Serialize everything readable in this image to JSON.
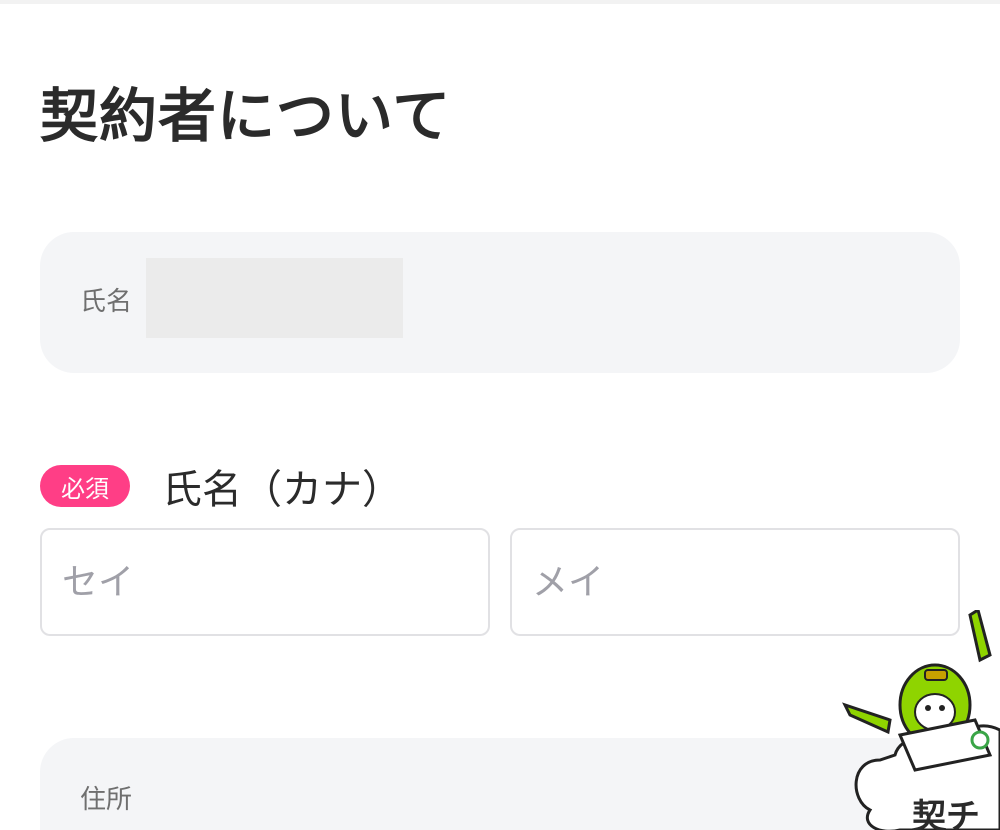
{
  "section": {
    "title": "契約者について"
  },
  "info_card": {
    "name_label": "氏名"
  },
  "kana_field": {
    "required_badge": "必須",
    "label": "氏名（カナ）",
    "sei_placeholder": "セイ",
    "mei_placeholder": "メイ"
  },
  "address_card": {
    "label": "住所"
  },
  "mascot": {
    "text": "契チ"
  },
  "colors": {
    "required_badge": "#ff3e86",
    "card_background": "#f4f5f7",
    "mascot_green": "#8fd400"
  }
}
